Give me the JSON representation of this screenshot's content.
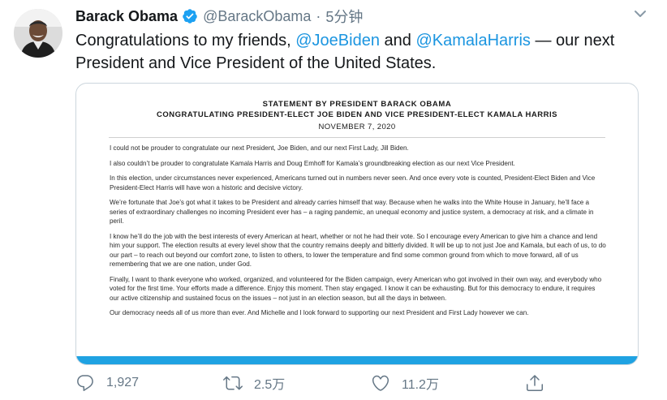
{
  "user": {
    "name": "Barack Obama",
    "handle": "@BarackObama",
    "separator": "·",
    "time": "5分钟"
  },
  "tweet": {
    "prefix": "Congratulations to my friends,",
    "mention1": "@JoeBiden",
    "and": "and",
    "mention2": "@KamalaHarris",
    "suffix": "— our next President and Vice President of the United States."
  },
  "statement": {
    "title": "STATEMENT BY PRESIDENT BARACK OBAMA",
    "subtitle": "CONGRATULATING PRESIDENT-ELECT JOE BIDEN AND VICE PRESIDENT-ELECT KAMALA HARRIS",
    "date": "NOVEMBER 7, 2020",
    "paragraphs": [
      "I could not be prouder to congratulate our next President, Joe Biden, and our next First Lady, Jill Biden.",
      "I also couldn’t be prouder to congratulate Kamala Harris and Doug Emhoff for Kamala’s groundbreaking election as our next Vice President.",
      "In this election, under circumstances never experienced, Americans turned out in numbers never seen. And once every vote is counted, President-Elect Biden and Vice President-Elect Harris will have won a historic and decisive victory.",
      "We’re fortunate that Joe’s got what it takes to be President and already carries himself that way. Because when he walks into the White House in January, he’ll face a series of extraordinary challenges no incoming President ever has – a raging pandemic, an unequal economy and justice system, a democracy at risk, and a climate in peril.",
      "I know he’ll do the job with the best interests of every American at heart, whether or not he had their vote. So I encourage every American to give him a chance and lend him your support. The election results at every level show that the country remains deeply and bitterly divided. It will be up to not just Joe and Kamala, but each of us, to do our part – to reach out beyond our comfort zone, to listen to others, to lower the temperature and find some common ground from which to move forward, all of us remembering that we are one nation, under God.",
      "Finally, I want to thank everyone who worked, organized, and volunteered for the Biden campaign, every American who got involved in their own way, and everybody who voted for the first time. Your efforts made a difference. Enjoy this moment. Then stay engaged. I know it can be exhausting. But for this democracy to endure, it requires our active citizenship and sustained focus on the issues – not just in an election season, but all the days in between.",
      "Our democracy needs all of us more than ever. And Michelle and I look forward to supporting our next President and First Lady however we can."
    ]
  },
  "actions": {
    "reply_count": "1,927",
    "retweet_count": "2.5万",
    "like_count": "11.2万"
  },
  "icons": [
    "verified-badge-icon",
    "caret-down-icon",
    "reply-icon",
    "retweet-icon",
    "like-icon",
    "share-icon"
  ],
  "colors": {
    "accent": "#1da1f2",
    "mention": "#1b95e0",
    "muted": "#657786",
    "card_bar": "#1fa2e2"
  }
}
